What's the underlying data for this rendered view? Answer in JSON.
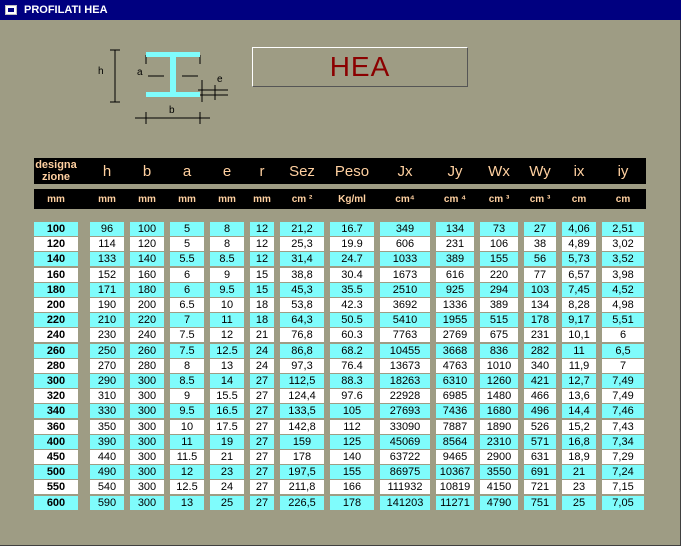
{
  "window": {
    "title": "PROFILATI   HEA"
  },
  "banner": {
    "text": "HEA"
  },
  "diagram": {
    "labels": {
      "h": "h",
      "a": "a",
      "e": "e",
      "b": "b"
    }
  },
  "colors": {
    "cyan": "#7ffcfc",
    "white": "#ffffff",
    "header_text": "#ffd0a0",
    "banner_text": "#8b0000"
  },
  "table": {
    "headers": [
      "designa zione",
      "h",
      "b",
      "a",
      "e",
      "r",
      "Sez",
      "Peso",
      "Jx",
      "Jy",
      "Wx",
      "Wy",
      "ix",
      "iy"
    ],
    "units": [
      "mm",
      "mm",
      "mm",
      "mm",
      "mm",
      "mm",
      "cm ²",
      "Kg/ml",
      "cm⁴",
      "cm ⁴",
      "cm ³",
      "cm ³",
      "cm",
      "cm"
    ],
    "rows": [
      [
        "100",
        "96",
        "100",
        "5",
        "8",
        "12",
        "21,2",
        "16.7",
        "349",
        "134",
        "73",
        "27",
        "4,06",
        "2,51"
      ],
      [
        "120",
        "114",
        "120",
        "5",
        "8",
        "12",
        "25,3",
        "19.9",
        "606",
        "231",
        "106",
        "38",
        "4,89",
        "3,02"
      ],
      [
        "140",
        "133",
        "140",
        "5.5",
        "8.5",
        "12",
        "31,4",
        "24.7",
        "1033",
        "389",
        "155",
        "56",
        "5,73",
        "3,52"
      ],
      [
        "160",
        "152",
        "160",
        "6",
        "9",
        "15",
        "38,8",
        "30.4",
        "1673",
        "616",
        "220",
        "77",
        "6,57",
        "3,98"
      ],
      [
        "180",
        "171",
        "180",
        "6",
        "9.5",
        "15",
        "45,3",
        "35.5",
        "2510",
        "925",
        "294",
        "103",
        "7,45",
        "4,52"
      ],
      [
        "200",
        "190",
        "200",
        "6.5",
        "10",
        "18",
        "53,8",
        "42.3",
        "3692",
        "1336",
        "389",
        "134",
        "8,28",
        "4,98"
      ],
      [
        "220",
        "210",
        "220",
        "7",
        "11",
        "18",
        "64,3",
        "50.5",
        "5410",
        "1955",
        "515",
        "178",
        "9,17",
        "5,51"
      ],
      [
        "240",
        "230",
        "240",
        "7.5",
        "12",
        "21",
        "76,8",
        "60.3",
        "7763",
        "2769",
        "675",
        "231",
        "10,1",
        "6"
      ],
      [
        "260",
        "250",
        "260",
        "7.5",
        "12.5",
        "24",
        "86,8",
        "68.2",
        "10455",
        "3668",
        "836",
        "282",
        "11",
        "6,5"
      ],
      [
        "280",
        "270",
        "280",
        "8",
        "13",
        "24",
        "97,3",
        "76.4",
        "13673",
        "4763",
        "1010",
        "340",
        "11,9",
        "7"
      ],
      [
        "300",
        "290",
        "300",
        "8.5",
        "14",
        "27",
        "112,5",
        "88.3",
        "18263",
        "6310",
        "1260",
        "421",
        "12,7",
        "7,49"
      ],
      [
        "320",
        "310",
        "300",
        "9",
        "15.5",
        "27",
        "124,4",
        "97.6",
        "22928",
        "6985",
        "1480",
        "466",
        "13,6",
        "7,49"
      ],
      [
        "340",
        "330",
        "300",
        "9.5",
        "16.5",
        "27",
        "133,5",
        "105",
        "27693",
        "7436",
        "1680",
        "496",
        "14,4",
        "7,46"
      ],
      [
        "360",
        "350",
        "300",
        "10",
        "17.5",
        "27",
        "142,8",
        "112",
        "33090",
        "7887",
        "1890",
        "526",
        "15,2",
        "7,43"
      ],
      [
        "400",
        "390",
        "300",
        "11",
        "19",
        "27",
        "159",
        "125",
        "45069",
        "8564",
        "2310",
        "571",
        "16,8",
        "7,34"
      ],
      [
        "450",
        "440",
        "300",
        "11.5",
        "21",
        "27",
        "178",
        "140",
        "63722",
        "9465",
        "2900",
        "631",
        "18,9",
        "7,29"
      ],
      [
        "500",
        "490",
        "300",
        "12",
        "23",
        "27",
        "197,5",
        "155",
        "86975",
        "10367",
        "3550",
        "691",
        "21",
        "7,24"
      ],
      [
        "550",
        "540",
        "300",
        "12.5",
        "24",
        "27",
        "211,8",
        "166",
        "111932",
        "10819",
        "4150",
        "721",
        "23",
        "7,15"
      ],
      [
        "600",
        "590",
        "300",
        "13",
        "25",
        "27",
        "226,5",
        "178",
        "141203",
        "11271",
        "4790",
        "751",
        "25",
        "7,05"
      ]
    ]
  }
}
